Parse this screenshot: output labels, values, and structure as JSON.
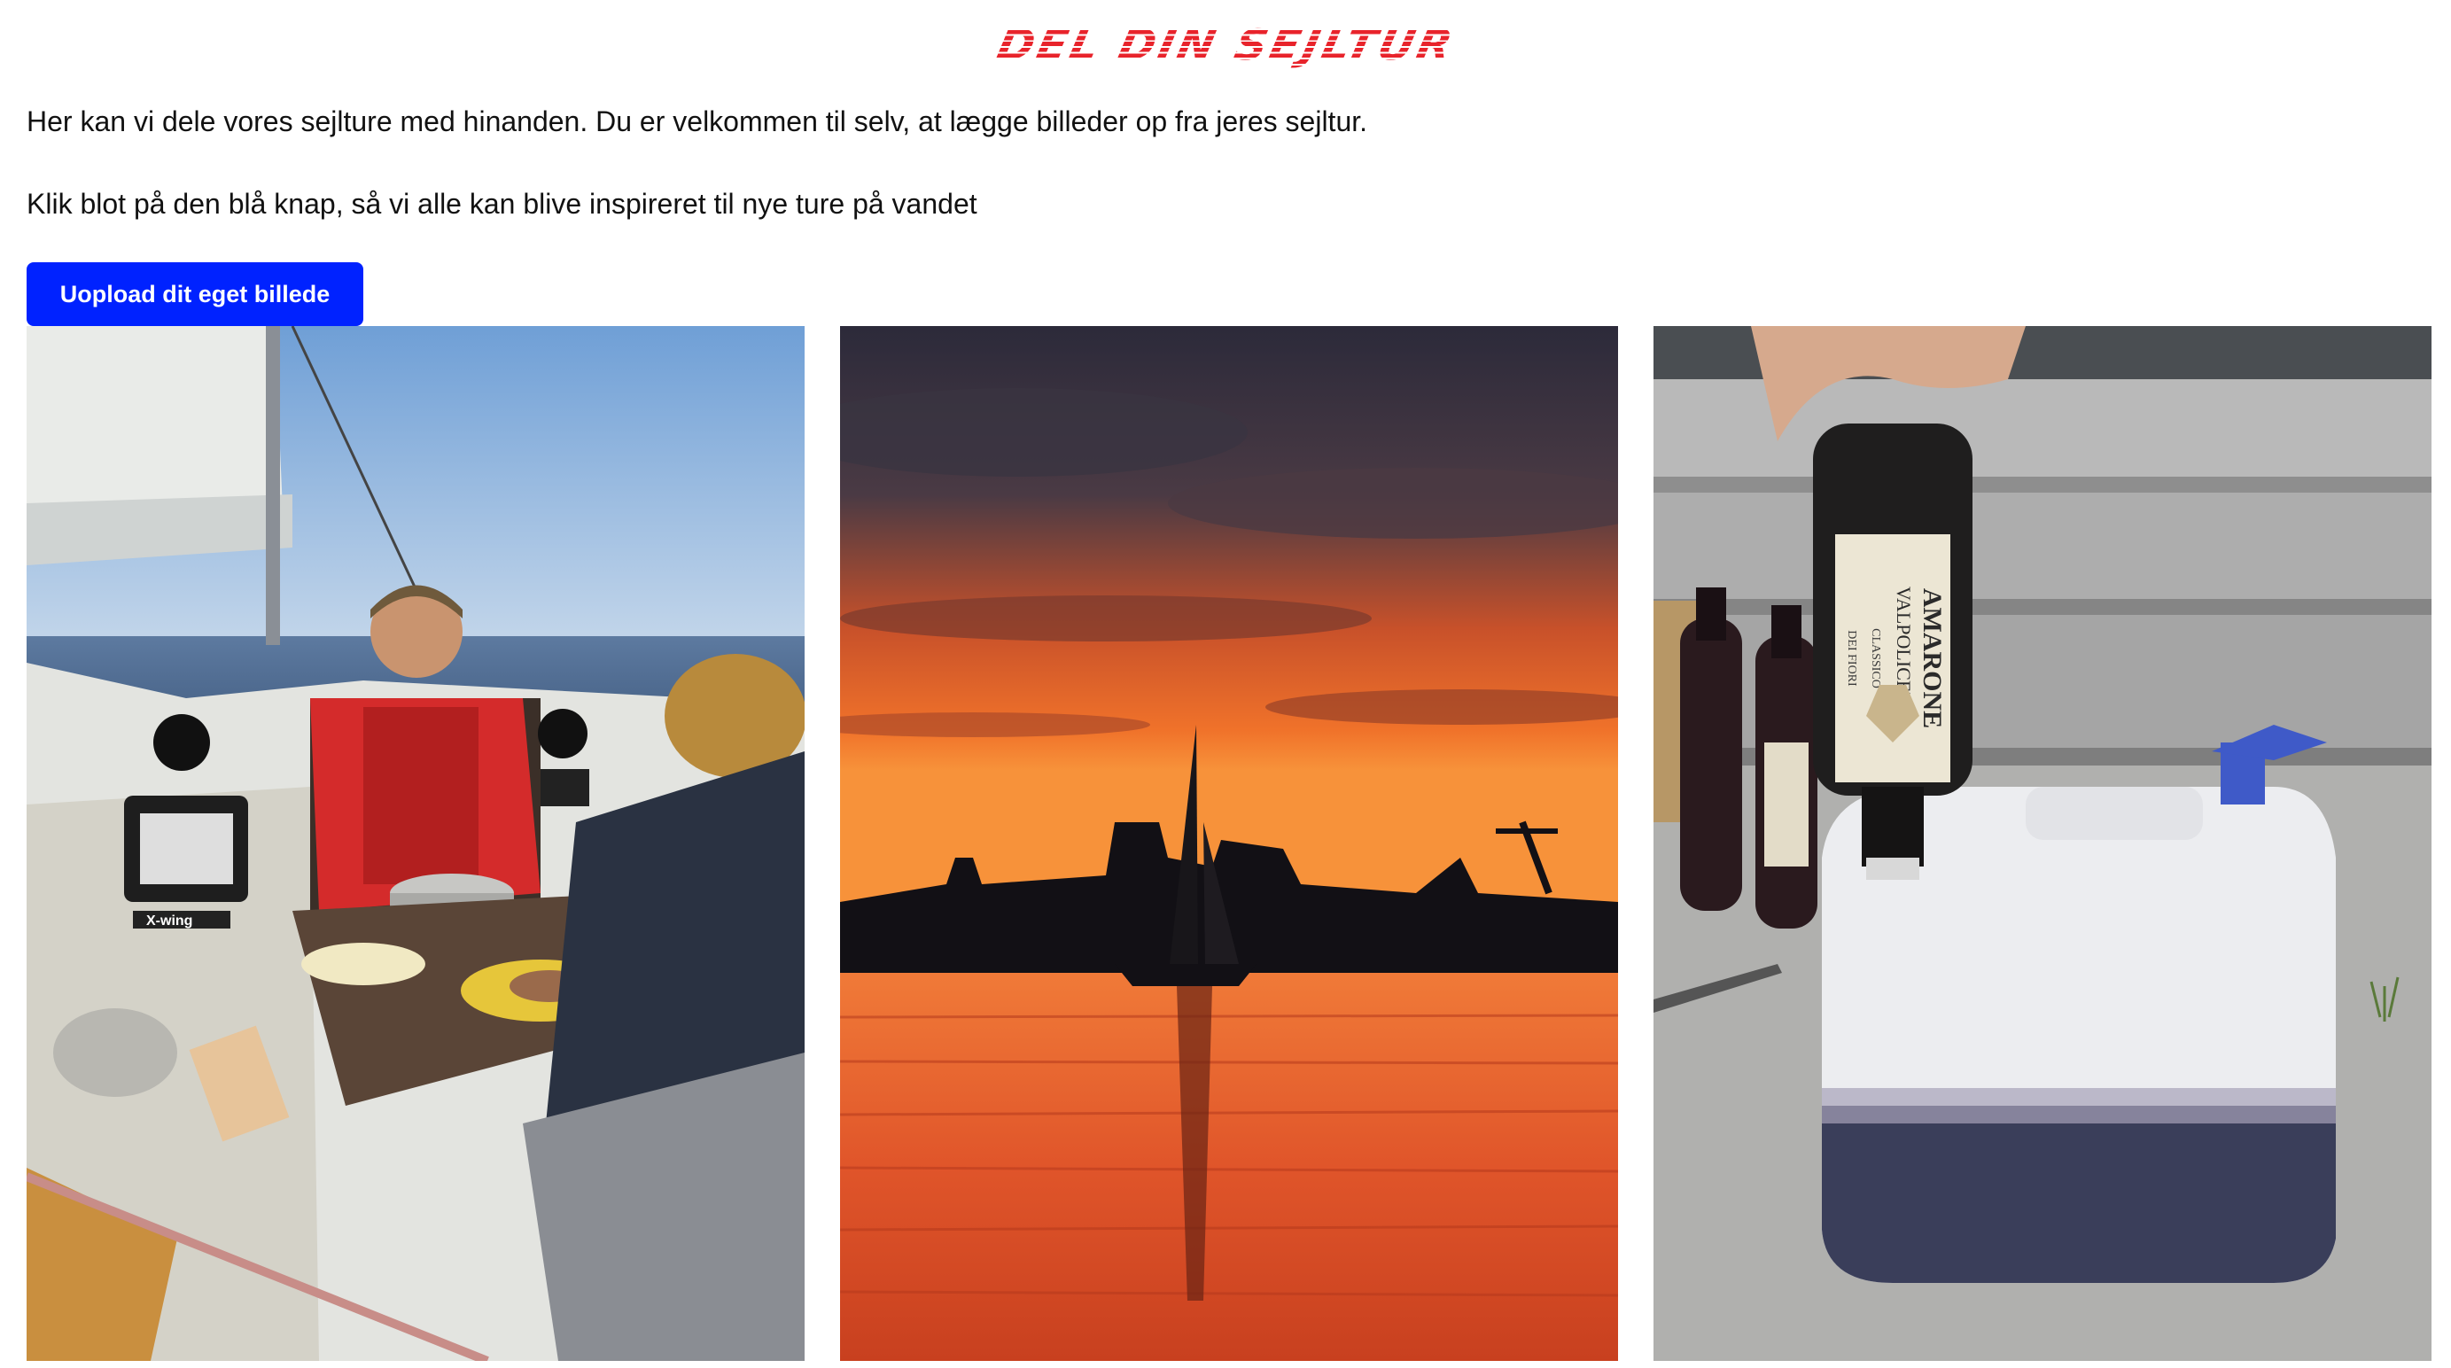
{
  "header": {
    "logo_text": "Del din sejltur"
  },
  "intro": {
    "line1": "Her kan vi dele vores sejlture med hinanden. Du er velkommen til selv, at lægge billeder op fra jeres sejltur.",
    "line2": "Klik blot på den blå knap, så vi alle kan blive inspireret til nye ture på vandet"
  },
  "upload_button": {
    "label": "Uopload dit eget billede",
    "color": "#0022ff"
  },
  "gallery": {
    "photos": [
      {
        "subject": "people eating aboard a sailboat"
      },
      {
        "subject": "sailboat silhouette at orange sunset"
      },
      {
        "subject": "wine bottle upended into a plastic canister"
      }
    ],
    "photo_labels": {
      "boat_brand": "X-wing",
      "wine_label_top": "DEI FIORI",
      "wine_label_main": "AMARONE",
      "wine_label_sub": "VALPOLICELLA",
      "wine_label_class": "CLASSICO"
    }
  },
  "colors": {
    "logo": "#e8232b",
    "button": "#0022ff",
    "text": "#111111"
  }
}
